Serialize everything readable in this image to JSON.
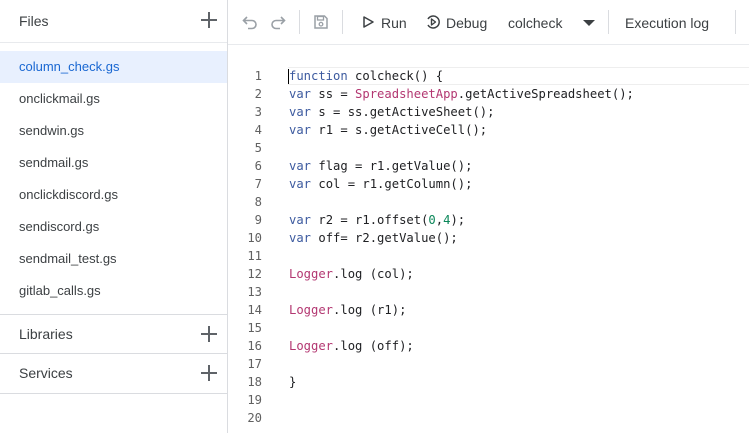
{
  "sidebar": {
    "files_title": "Files",
    "files": [
      {
        "name": "column_check.gs",
        "active": true
      },
      {
        "name": "onclickmail.gs"
      },
      {
        "name": "sendwin.gs"
      },
      {
        "name": "sendmail.gs"
      },
      {
        "name": "onclickdiscord.gs"
      },
      {
        "name": "sendiscord.gs"
      },
      {
        "name": "sendmail_test.gs"
      },
      {
        "name": "gitlab_calls.gs"
      }
    ],
    "libraries_title": "Libraries",
    "services_title": "Services"
  },
  "toolbar": {
    "undo_icon": "undo-icon",
    "redo_icon": "redo-icon",
    "save_icon": "save-icon",
    "run_label": "Run",
    "debug_label": "Debug",
    "function_select": "colcheck",
    "execution_log_label": "Execution log"
  },
  "editor": {
    "lines": [
      {
        "n": "1",
        "html": "<span class=\"kw\">function</span> colcheck() {"
      },
      {
        "n": "2",
        "html": "<span class=\"kw\">var</span> ss = <span class=\"cls\">SpreadsheetApp</span>.getActiveSpreadsheet();"
      },
      {
        "n": "3",
        "html": "<span class=\"kw\">var</span> s = ss.getActiveSheet();"
      },
      {
        "n": "4",
        "html": "<span class=\"kw\">var</span> r1 = s.getActiveCell();"
      },
      {
        "n": "5",
        "html": ""
      },
      {
        "n": "6",
        "html": "<span class=\"kw\">var</span> flag = r1.getValue();"
      },
      {
        "n": "7",
        "html": "<span class=\"kw\">var</span> col = r1.getColumn();"
      },
      {
        "n": "8",
        "html": ""
      },
      {
        "n": "9",
        "html": "<span class=\"kw\">var</span> r2 = r1.offset(<span class=\"num\">0</span>,<span class=\"num\">4</span>);"
      },
      {
        "n": "10",
        "html": "<span class=\"kw\">var</span> off= r2.getValue();"
      },
      {
        "n": "11",
        "html": ""
      },
      {
        "n": "12",
        "html": "<span class=\"cls\">Logger</span>.log (col);"
      },
      {
        "n": "13",
        "html": ""
      },
      {
        "n": "14",
        "html": "<span class=\"cls\">Logger</span>.log (r1);"
      },
      {
        "n": "15",
        "html": ""
      },
      {
        "n": "16",
        "html": "<span class=\"cls\">Logger</span>.log (off);"
      },
      {
        "n": "17",
        "html": ""
      },
      {
        "n": "18",
        "html": "}"
      },
      {
        "n": "19",
        "html": ""
      },
      {
        "n": "20",
        "html": ""
      }
    ]
  }
}
